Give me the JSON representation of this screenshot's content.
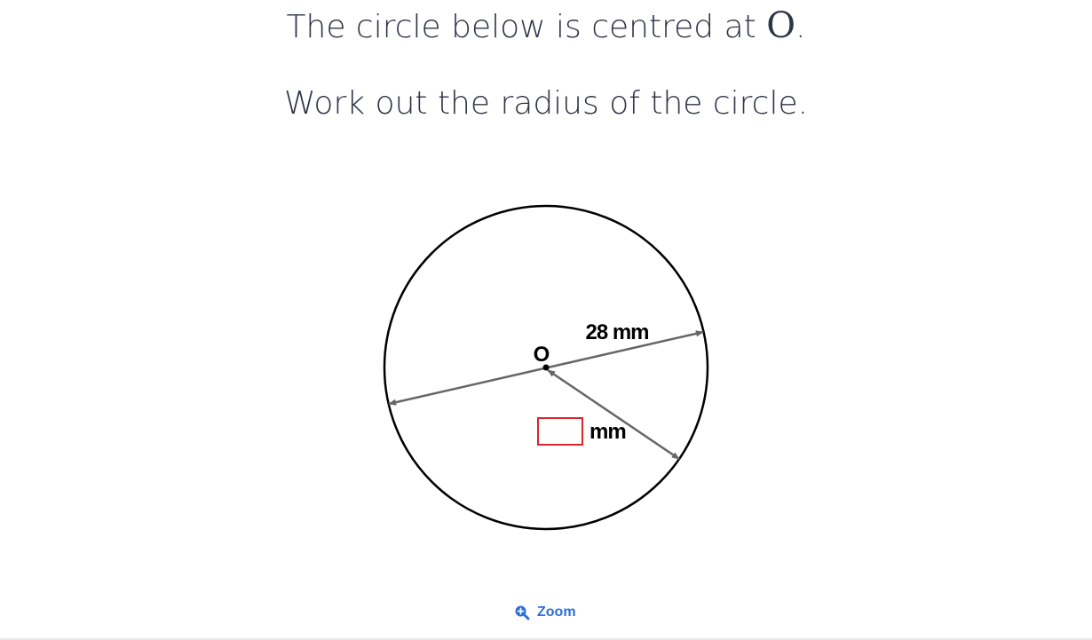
{
  "question": {
    "line1_text": "The circle below is centred at",
    "line1_symbol": "O",
    "line1_end": ".",
    "line2": "Work out the radius of the circle."
  },
  "diagram": {
    "centre_label": "O",
    "diameter_label": "28 mm",
    "radius_unit": "mm",
    "answer_value": ""
  },
  "zoom": {
    "label": "Zoom",
    "icon": "zoom-in-icon"
  },
  "colors": {
    "text": "#2f3447",
    "arrow": "#666666",
    "answer_box": "#d9252b",
    "link": "#2f6fd8"
  }
}
